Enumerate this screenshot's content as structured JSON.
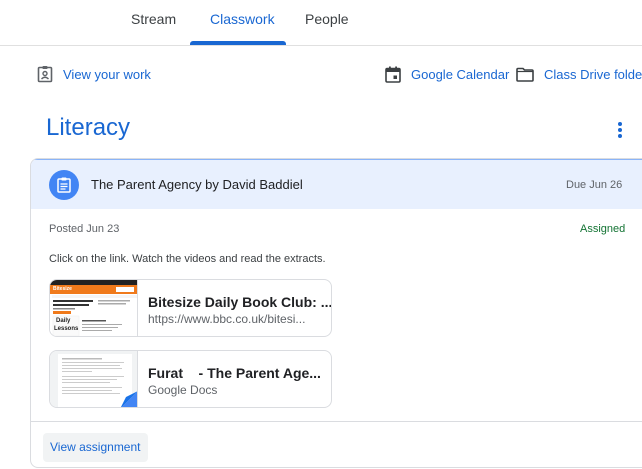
{
  "tabs": {
    "stream": "Stream",
    "classwork": "Classwork",
    "people": "People"
  },
  "actions": {
    "view_work": "View your work",
    "calendar": "Google Calendar",
    "drive": "Class Drive folder"
  },
  "topic": {
    "title": "Literacy"
  },
  "assignment": {
    "title": "The Parent Agency by David Baddiel",
    "due": "Due Jun 26",
    "posted": "Posted Jun 23",
    "status": "Assigned",
    "instructions": "Click on the link. Watch the videos and read the extracts.",
    "attachments": [
      {
        "title": "Bitesize Daily Book Club: ...",
        "subtitle": "https://www.bbc.co.uk/bitesi...",
        "thumb_label_1": "Bitesize",
        "thumb_label_2": "Daily",
        "thumb_label_3": "Lessons"
      },
      {
        "title": "Furat    - The Parent Age...",
        "subtitle": "Google Docs"
      }
    ],
    "view_button": "View assignment"
  },
  "colors": {
    "accent": "#1967d2",
    "header_bg": "#e8f0fe",
    "icon_bg": "#4285f4",
    "status": "#137333",
    "bbc_orange": "#f07a1b"
  }
}
